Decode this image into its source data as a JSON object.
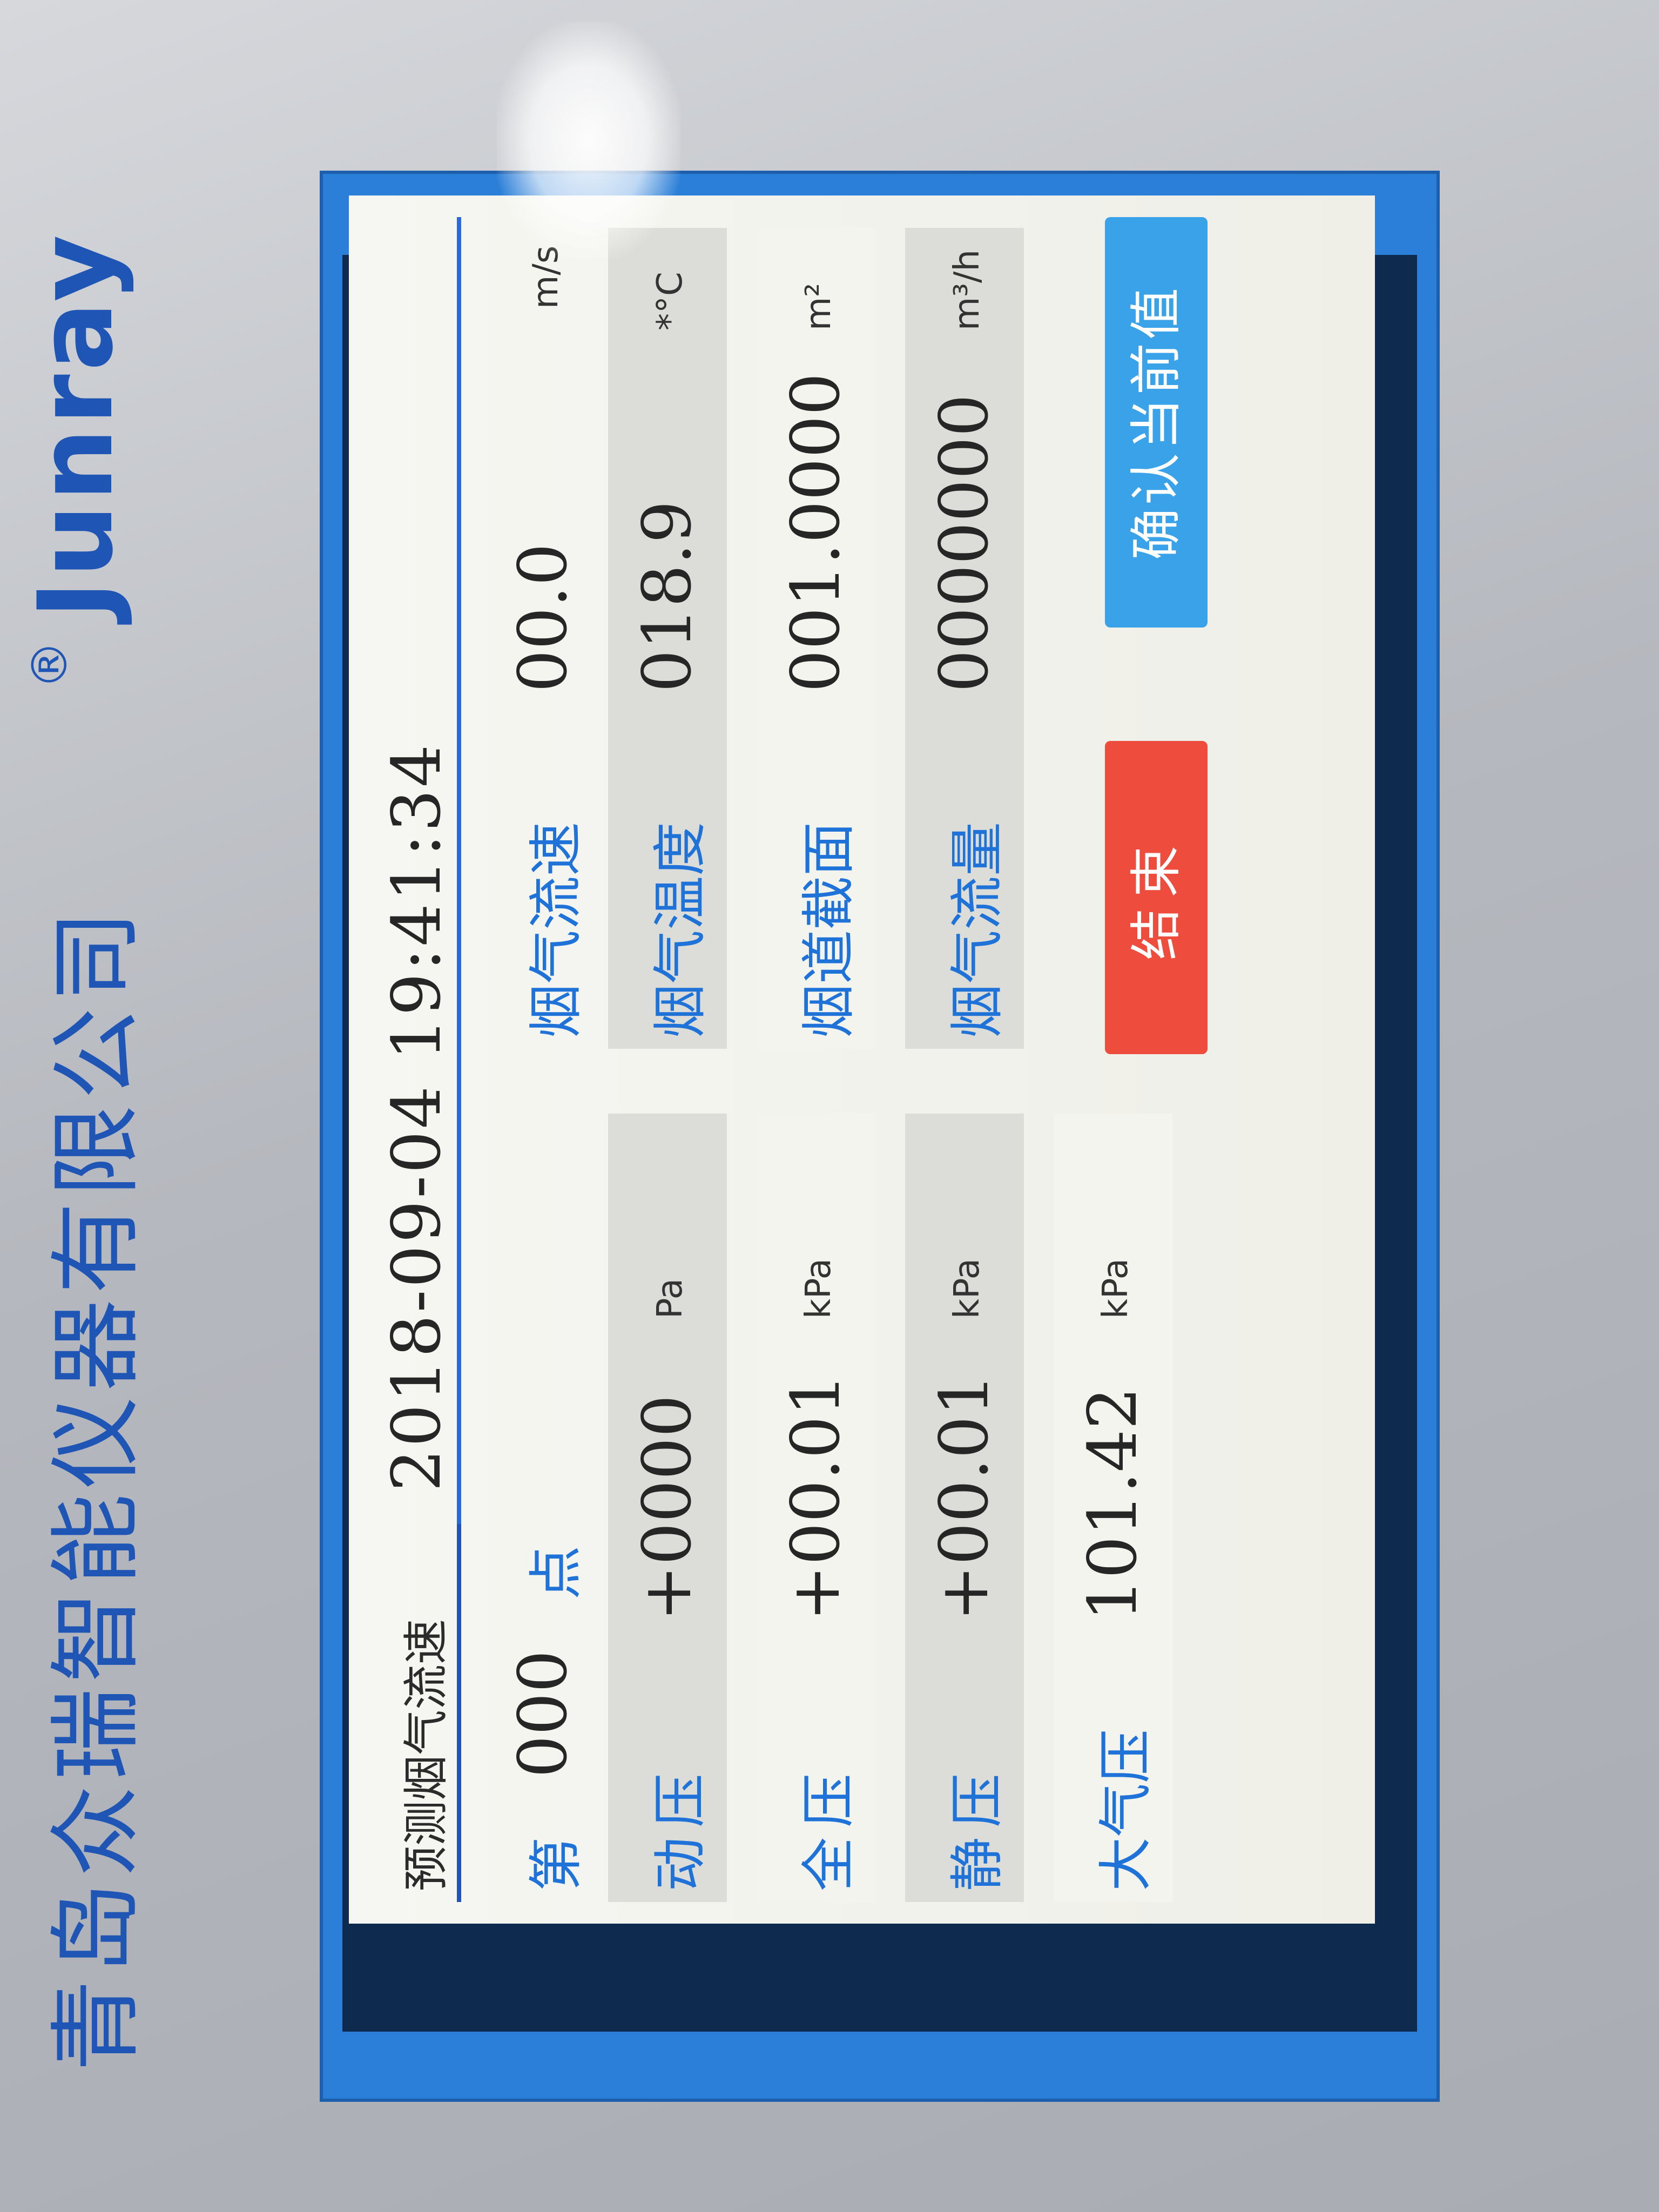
{
  "casing": {
    "brand": "Junray",
    "registered": "®",
    "company": "青岛众瑞智能仪器有限公司"
  },
  "header": {
    "title": "预测烟气流速",
    "datetime": "2018-09-04 19:41:34"
  },
  "point": {
    "prefix": "第",
    "number": "000",
    "suffix": "点"
  },
  "left_rows": [
    {
      "label": "动压",
      "value": "+0000",
      "unit": "Pa"
    },
    {
      "label": "全压",
      "value": "+00.01",
      "unit": "kPa"
    },
    {
      "label": "静压",
      "value": "+00.01",
      "unit": "kPa"
    },
    {
      "label": "大气压",
      "value": "101.42",
      "unit": "kPa"
    }
  ],
  "right_rows": [
    {
      "label": "烟气流速",
      "value": "00.0",
      "unit": "m/s"
    },
    {
      "label": "烟气温度",
      "value": "018.9",
      "unit": "*°C"
    },
    {
      "label": "烟道截面",
      "value": "001.0000",
      "unit": "m²"
    },
    {
      "label": "烟气流量",
      "value": "0000000",
      "unit": "m³/h"
    }
  ],
  "buttons": {
    "end": "结束",
    "confirm": "确认当前值"
  },
  "colors": {
    "bezel": "#2b7fd8",
    "label_blue": "#1f73d8",
    "end_button": "#ee4c3c",
    "confirm_button": "#39a2e8"
  }
}
